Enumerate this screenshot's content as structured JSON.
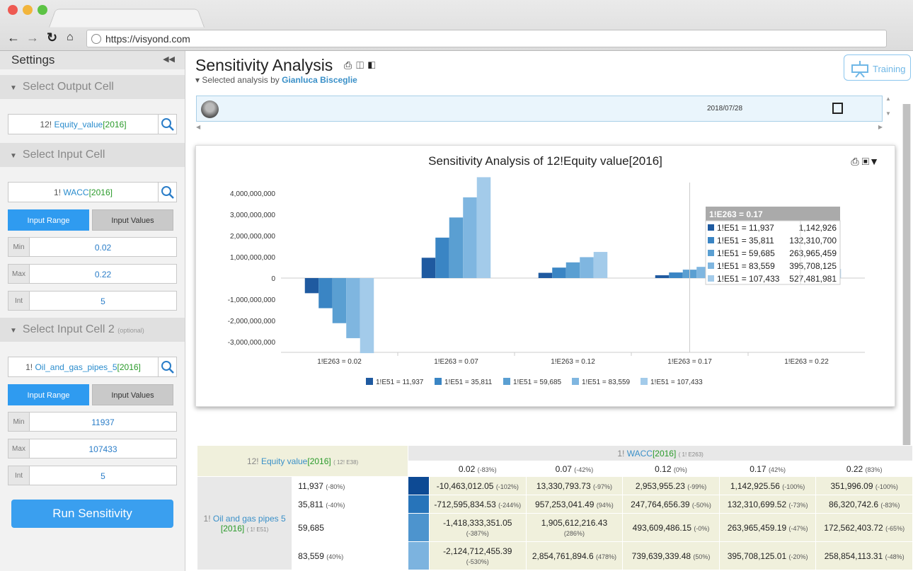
{
  "browser": {
    "url": "https://visyond.com"
  },
  "sidebar": {
    "title": "Settings",
    "output_section": "Select Output Cell",
    "output_cell": {
      "prefix": "12!",
      "name": "Equity_value",
      "bracket": "[2016]"
    },
    "input_section": "Select Input Cell",
    "input_cell": {
      "prefix": "1!",
      "name": "WACC",
      "bracket": "[2016]"
    },
    "input_range_label": "Input Range",
    "input_values_label": "Input Values",
    "range1": {
      "min_label": "Min",
      "min": "0.02",
      "max_label": "Max",
      "max": "0.22",
      "int_label": "Int",
      "int": "5"
    },
    "input2_section": "Select Input Cell 2",
    "input2_optional": "(optional)",
    "input2_cell": {
      "prefix": "1!",
      "name": "Oil_and_gas_pipes_5",
      "bracket": "[2016]"
    },
    "range2": {
      "min_label": "Min",
      "min": "11937",
      "max_label": "Max",
      "max": "107433",
      "int_label": "Int",
      "int": "5"
    },
    "run_label": "Run Sensitivity"
  },
  "page": {
    "title": "Sensitivity Analysis",
    "subtitle_prefix": "Selected analysis by",
    "author": "Gianluca Bisceglie",
    "training_label": "Training",
    "date": "2018/07/28"
  },
  "chart_data": {
    "type": "bar",
    "title": "Sensitivity Analysis of 12!Equity value[2016]",
    "categories": [
      "1!E263 = 0.02",
      "1!E263 = 0.07",
      "1!E263 = 0.12",
      "1!E263 = 0.17",
      "1!E263 = 0.22"
    ],
    "ylim": [
      -3500000000,
      4500000000
    ],
    "yticks": [
      4000000000,
      3000000000,
      2000000000,
      1000000000,
      0,
      -1000000000,
      -2000000000,
      -3000000000
    ],
    "ytick_labels": [
      "4,000,000,000",
      "3,000,000,000",
      "2,000,000,000",
      "1,000,000,000",
      "0",
      "-1,000,000,000",
      "-2,000,000,000",
      "-3,000,000,000"
    ],
    "legend_position": "bottom",
    "series": [
      {
        "name": "1!E51 = 11,937",
        "color": "#1f5aa0",
        "values": [
          -712595834,
          957253041,
          247764656,
          132310700,
          86320743
        ]
      },
      {
        "name": "1!E51 = 35,811",
        "color": "#3a85c4",
        "values": [
          -1418333351,
          1905612216,
          493609486,
          263965459,
          172562404
        ]
      },
      {
        "name": "1!E51 = 59,685",
        "color": "#5a9fd2",
        "values": [
          -2124712455,
          2854761895,
          739639339,
          395708125,
          258854113
        ]
      },
      {
        "name": "1!E51 = 83,559",
        "color": "#7fb6e0",
        "values": [
          -2831000000,
          3803000000,
          985000000,
          527481981,
          345000000
        ]
      },
      {
        "name": "1!E51 = 107,433",
        "color": "#a3cbea",
        "values": [
          -3537000000,
          4752000000,
          1231000000,
          659000000,
          431000000
        ]
      }
    ],
    "tooltip": {
      "title": "1!E263 = 0.17",
      "rows": [
        {
          "label": "1!E51 = 11,937",
          "value": "1,142,926"
        },
        {
          "label": "1!E51 = 35,811",
          "value": "132,310,700"
        },
        {
          "label": "1!E51 = 59,685",
          "value": "263,965,459"
        },
        {
          "label": "1!E51 = 83,559",
          "value": "395,708,125"
        },
        {
          "label": "1!E51 = 107,433",
          "value": "527,481,981"
        }
      ]
    }
  },
  "table": {
    "corner": {
      "prefix": "12!",
      "name": "Equity value",
      "bracket": "[2016]",
      "ref": "( 12! E38)"
    },
    "col_header": {
      "prefix": "1!",
      "name": "WACC",
      "bracket": "[2016]",
      "ref": "( 1! E263)"
    },
    "cols": [
      {
        "v": "0.02",
        "p": "(-83%)"
      },
      {
        "v": "0.07",
        "p": "(-42%)"
      },
      {
        "v": "0.12",
        "p": "(0%)"
      },
      {
        "v": "0.17",
        "p": "(42%)"
      },
      {
        "v": "0.22",
        "p": "(83%)"
      }
    ],
    "row_header": {
      "prefix": "1!",
      "name": "Oil and gas pipes 5",
      "bracket": "[2016]",
      "ref": "( 1! E51)"
    },
    "rows": [
      {
        "v": "11,937",
        "p": "(-80%)",
        "color": "#0d4a94",
        "cells": [
          [
            "-10,463,012.05",
            "(-102%)"
          ],
          [
            "13,330,793.73",
            "(-97%)"
          ],
          [
            "2,953,955.23",
            "(-99%)"
          ],
          [
            "1,142,925.56",
            "(-100%)"
          ],
          [
            "351,996.09",
            "(-100%)"
          ]
        ]
      },
      {
        "v": "35,811",
        "p": "(-40%)",
        "color": "#2774ba",
        "cells": [
          [
            "-712,595,834.53",
            "(-244%)"
          ],
          [
            "957,253,041.49",
            "(94%)"
          ],
          [
            "247,764,656.39",
            "(-50%)"
          ],
          [
            "132,310,699.52",
            "(-73%)"
          ],
          [
            "86,320,742.6",
            "(-83%)"
          ]
        ]
      },
      {
        "v": "59,685",
        "p": "",
        "color": "#4d94ce",
        "cells": [
          [
            "-1,418,333,351.05",
            "(-387%)"
          ],
          [
            "1,905,612,216.43",
            "(286%)"
          ],
          [
            "493,609,486.15",
            "(-0%)"
          ],
          [
            "263,965,459.19",
            "(-47%)"
          ],
          [
            "172,562,403.72",
            "(-65%)"
          ]
        ]
      },
      {
        "v": "83,559",
        "p": "(40%)",
        "color": "#7cb3df",
        "cells": [
          [
            "-2,124,712,455.39",
            "(-530%)"
          ],
          [
            "2,854,761,894.6",
            "(478%)"
          ],
          [
            "739,639,339.48",
            "(50%)"
          ],
          [
            "395,708,125.01",
            "(-20%)"
          ],
          [
            "258,854,113.31",
            "(-48%)"
          ]
        ]
      }
    ]
  }
}
